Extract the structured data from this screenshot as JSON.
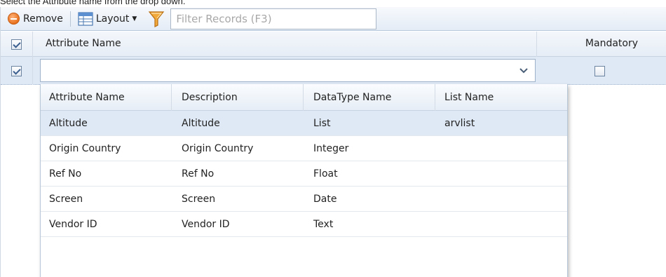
{
  "caption": "Select the Attribute name from the drop down.",
  "toolbar": {
    "remove_label": "Remove",
    "layout_label": "Layout",
    "filter_placeholder": "Filter Records (F3)"
  },
  "grid": {
    "header": {
      "select_all_checked": true,
      "attribute_name": "Attribute Name",
      "mandatory": "Mandatory"
    },
    "edit_row": {
      "checked": true,
      "attribute_value": "",
      "mandatory_checked": false
    }
  },
  "dropdown": {
    "columns": [
      "Attribute Name",
      "Description",
      "DataType Name",
      "List Name"
    ],
    "rows": [
      {
        "attribute_name": "Altitude",
        "description": "Altitude",
        "datatype": "List",
        "list_name": "arvlist",
        "selected": true
      },
      {
        "attribute_name": "Origin Country",
        "description": "Origin Country",
        "datatype": "Integer",
        "list_name": ""
      },
      {
        "attribute_name": "Ref No",
        "description": "Ref No",
        "datatype": "Float",
        "list_name": ""
      },
      {
        "attribute_name": "Screen",
        "description": "Screen",
        "datatype": "Date",
        "list_name": ""
      },
      {
        "attribute_name": "Vendor ID",
        "description": "Vendor ID",
        "datatype": "Text",
        "list_name": ""
      }
    ]
  },
  "colors": {
    "accent": "#3b5f8f",
    "selected_row": "#dfe9f5",
    "toolbar_bg": "#e4ecf6",
    "remove_icon": "#e8731f"
  },
  "icons": {
    "remove": "remove-icon",
    "layout": "layout-grid-icon",
    "filter": "filter-funnel-icon",
    "combo": "chevron-down-icon"
  }
}
